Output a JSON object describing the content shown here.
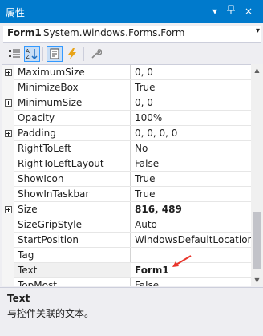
{
  "window": {
    "title": "属性",
    "pin_glyph": "▾",
    "pin2_glyph": "ᵖ",
    "close_glyph": "×"
  },
  "object": {
    "name": "Form1",
    "type": "System.Windows.Forms.Form"
  },
  "toolbar": {
    "tools": [
      "categorized-icon",
      "alphabetical-icon",
      "properties-icon",
      "events-icon",
      "property-pages-icon"
    ]
  },
  "properties": [
    {
      "name": "MaximumSize",
      "value": "0, 0",
      "expandable": true,
      "bold": false
    },
    {
      "name": "MinimizeBox",
      "value": "True",
      "expandable": false,
      "bold": false
    },
    {
      "name": "MinimumSize",
      "value": "0, 0",
      "expandable": true,
      "bold": false
    },
    {
      "name": "Opacity",
      "value": "100%",
      "expandable": false,
      "bold": false
    },
    {
      "name": "Padding",
      "value": "0, 0, 0, 0",
      "expandable": true,
      "bold": false
    },
    {
      "name": "RightToLeft",
      "value": "No",
      "expandable": false,
      "bold": false
    },
    {
      "name": "RightToLeftLayout",
      "value": "False",
      "expandable": false,
      "bold": false
    },
    {
      "name": "ShowIcon",
      "value": "True",
      "expandable": false,
      "bold": false
    },
    {
      "name": "ShowInTaskbar",
      "value": "True",
      "expandable": false,
      "bold": false
    },
    {
      "name": "Size",
      "value": "816, 489",
      "expandable": true,
      "bold": true
    },
    {
      "name": "SizeGripStyle",
      "value": "Auto",
      "expandable": false,
      "bold": false
    },
    {
      "name": "StartPosition",
      "value": "WindowsDefaultLocation",
      "expandable": false,
      "bold": false
    },
    {
      "name": "Tag",
      "value": "",
      "expandable": false,
      "bold": false
    },
    {
      "name": "Text",
      "value": "Form1",
      "expandable": false,
      "bold": true,
      "selected": true
    },
    {
      "name": "TopMost",
      "value": "False",
      "expandable": false,
      "bold": false
    }
  ],
  "description": {
    "title": "Text",
    "text": "与控件关联的文本。"
  },
  "colors": {
    "accent": "#007acc",
    "annotation_arrow": "#e8342a"
  }
}
